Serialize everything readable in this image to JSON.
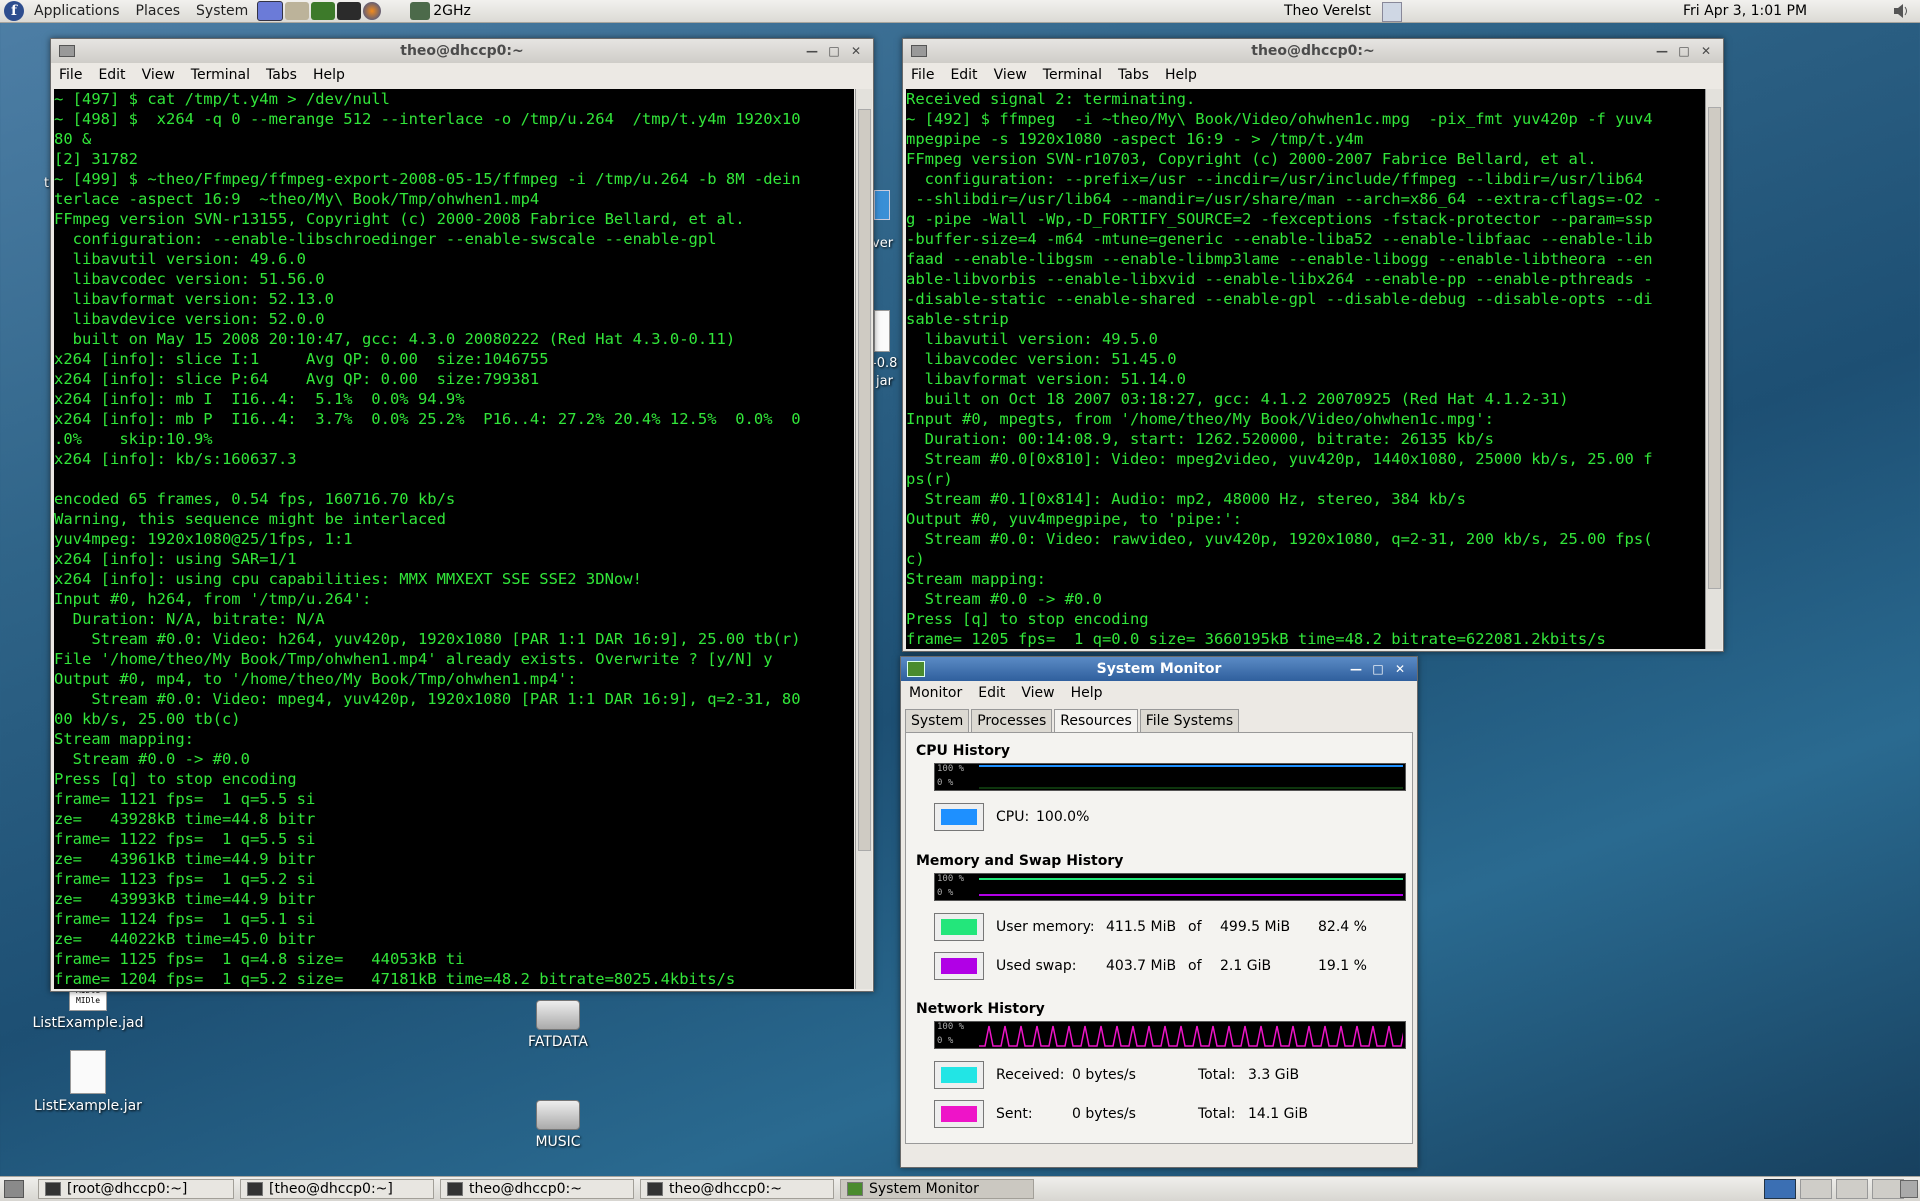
{
  "top_panel": {
    "menus": [
      "Applications",
      "Places",
      "System"
    ],
    "cpu_freq": "2GHz",
    "user": "Theo Verelst",
    "clock": "Fri Apr  3,  1:01 PM"
  },
  "desktop_icons": [
    {
      "label": "ListExample.jad",
      "badge": "MIDle"
    },
    {
      "label": "ListExample.jar"
    },
    {
      "label": "FATDATA"
    },
    {
      "label": "MUSIC"
    }
  ],
  "partial_icon_text": [
    "t",
    "ver",
    "-0.8",
    "jar"
  ],
  "terminal_left": {
    "title": "theo@dhccp0:~",
    "menus": [
      "File",
      "Edit",
      "View",
      "Terminal",
      "Tabs",
      "Help"
    ],
    "lines": [
      "~ [497] $ cat /tmp/t.y4m > /dev/null",
      "~ [498] $  x264 -q 0 --merange 512 --interlace -o /tmp/u.264  /tmp/t.y4m 1920x10",
      "80 &",
      "[2] 31782",
      "~ [499] $ ~theo/Ffmpeg/ffmpeg-export-2008-05-15/ffmpeg -i /tmp/u.264 -b 8M -dein",
      "terlace -aspect 16:9  ~theo/My\\ Book/Tmp/ohwhen1.mp4",
      "FFmpeg version SVN-r13155, Copyright (c) 2000-2008 Fabrice Bellard, et al.",
      "  configuration: --enable-libschroedinger --enable-swscale --enable-gpl",
      "  libavutil version: 49.6.0",
      "  libavcodec version: 51.56.0",
      "  libavformat version: 52.13.0",
      "  libavdevice version: 52.0.0",
      "  built on May 15 2008 20:10:47, gcc: 4.3.0 20080222 (Red Hat 4.3.0-0.11)",
      "x264 [info]: slice I:1     Avg QP: 0.00  size:1046755",
      "x264 [info]: slice P:64    Avg QP: 0.00  size:799381",
      "x264 [info]: mb I  I16..4:  5.1%  0.0% 94.9%",
      "x264 [info]: mb P  I16..4:  3.7%  0.0% 25.2%  P16..4: 27.2% 20.4% 12.5%  0.0%  0",
      ".0%    skip:10.9%",
      "x264 [info]: kb/s:160637.3",
      "",
      "encoded 65 frames, 0.54 fps, 160716.70 kb/s",
      "Warning, this sequence might be interlaced",
      "yuv4mpeg: 1920x1080@25/1fps, 1:1",
      "x264 [info]: using SAR=1/1",
      "x264 [info]: using cpu capabilities: MMX MMXEXT SSE SSE2 3DNow!",
      "Input #0, h264, from '/tmp/u.264':",
      "  Duration: N/A, bitrate: N/A",
      "    Stream #0.0: Video: h264, yuv420p, 1920x1080 [PAR 1:1 DAR 16:9], 25.00 tb(r)",
      "File '/home/theo/My Book/Tmp/ohwhen1.mp4' already exists. Overwrite ? [y/N] y",
      "Output #0, mp4, to '/home/theo/My Book/Tmp/ohwhen1.mp4':",
      "    Stream #0.0: Video: mpeg4, yuv420p, 1920x1080 [PAR 1:1 DAR 16:9], q=2-31, 80",
      "00 kb/s, 25.00 tb(c)",
      "Stream mapping:",
      "  Stream #0.0 -> #0.0",
      "Press [q] to stop encoding",
      "frame= 1121 fps=  1 q=5.5 si",
      "ze=   43928kB time=44.8 bitr",
      "frame= 1122 fps=  1 q=5.5 si",
      "ze=   43961kB time=44.9 bitr",
      "frame= 1123 fps=  1 q=5.2 si",
      "ze=   43993kB time=44.9 bitr",
      "frame= 1124 fps=  1 q=5.1 si",
      "ze=   44022kB time=45.0 bitr",
      "frame= 1125 fps=  1 q=4.8 size=   44053kB ti",
      "frame= 1204 fps=  1 q=5.2 size=   47181kB time=48.2 bitrate=8025.4kbits/s"
    ]
  },
  "terminal_right": {
    "title": "theo@dhccp0:~",
    "menus": [
      "File",
      "Edit",
      "View",
      "Terminal",
      "Tabs",
      "Help"
    ],
    "lines": [
      "Received signal 2: terminating.",
      "~ [492] $ ffmpeg  -i ~theo/My\\ Book/Video/ohwhen1c.mpg  -pix_fmt yuv420p -f yuv4",
      "mpegpipe -s 1920x1080 -aspect 16:9 - > /tmp/t.y4m",
      "FFmpeg version SVN-r10703, Copyright (c) 2000-2007 Fabrice Bellard, et al.",
      "  configuration: --prefix=/usr --incdir=/usr/include/ffmpeg --libdir=/usr/lib64",
      " --shlibdir=/usr/lib64 --mandir=/usr/share/man --arch=x86_64 --extra-cflags=-O2 -",
      "g -pipe -Wall -Wp,-D_FORTIFY_SOURCE=2 -fexceptions -fstack-protector --param=ssp",
      "-buffer-size=4 -m64 -mtune=generic --enable-liba52 --enable-libfaac --enable-lib",
      "faad --enable-libgsm --enable-libmp3lame --enable-libogg --enable-libtheora --en",
      "able-libvorbis --enable-libxvid --enable-libx264 --enable-pp --enable-pthreads -",
      "-disable-static --enable-shared --enable-gpl --disable-debug --disable-opts --di",
      "sable-strip",
      "  libavutil version: 49.5.0",
      "  libavcodec version: 51.45.0",
      "  libavformat version: 51.14.0",
      "  built on Oct 18 2007 03:18:27, gcc: 4.1.2 20070925 (Red Hat 4.1.2-31)",
      "Input #0, mpegts, from '/home/theo/My Book/Video/ohwhen1c.mpg':",
      "  Duration: 00:14:08.9, start: 1262.520000, bitrate: 26135 kb/s",
      "  Stream #0.0[0x810]: Video: mpeg2video, yuv420p, 1440x1080, 25000 kb/s, 25.00 f",
      "ps(r)",
      "  Stream #0.1[0x814]: Audio: mp2, 48000 Hz, stereo, 384 kb/s",
      "Output #0, yuv4mpegpipe, to 'pipe:':",
      "  Stream #0.0: Video: rawvideo, yuv420p, 1920x1080, q=2-31, 200 kb/s, 25.00 fps(",
      "c)",
      "Stream mapping:",
      "  Stream #0.0 -> #0.0",
      "Press [q] to stop encoding",
      "frame= 1205 fps=  1 q=0.0 size= 3660195kB time=48.2 bitrate=622081.2kbits/s"
    ]
  },
  "system_monitor": {
    "title": "System Monitor",
    "menus": [
      "Monitor",
      "Edit",
      "View",
      "Help"
    ],
    "tabs": [
      "System",
      "Processes",
      "Resources",
      "File Systems"
    ],
    "active_tab": "Resources",
    "graph_labels": {
      "top": "100 %",
      "bottom": "0 %"
    },
    "cpu": {
      "heading": "CPU History",
      "label": "CPU:",
      "value": "100.0%",
      "color": "#1e90ff",
      "percent": 100
    },
    "memory": {
      "heading": "Memory and Swap History",
      "user_label": "User memory:",
      "user_used": "411.5 MiB",
      "of": "of",
      "user_total": "499.5 MiB",
      "user_pct": "82.4 %",
      "user_color": "#23e67b",
      "swap_label": "Used swap:",
      "swap_used": "403.7 MiB",
      "swap_total": "2.1 GiB",
      "swap_pct": "19.1 %",
      "swap_color": "#b100e6"
    },
    "network": {
      "heading": "Network History",
      "recv_label": "Received:",
      "recv_rate": "0 bytes/s",
      "recv_total_label": "Total:",
      "recv_total": "3.3 GiB",
      "recv_color": "#22e5e5",
      "sent_label": "Sent:",
      "sent_rate": "0 bytes/s",
      "sent_total_label": "Total:",
      "sent_total": "14.1 GiB",
      "sent_color": "#ee14c8"
    }
  },
  "taskbar": [
    {
      "label": "[root@dhccp0:~]",
      "active": false
    },
    {
      "label": "[theo@dhccp0:~]",
      "active": false
    },
    {
      "label": "theo@dhccp0:~",
      "active": false
    },
    {
      "label": "theo@dhccp0:~",
      "active": false
    },
    {
      "label": "System Monitor",
      "active": true
    }
  ]
}
